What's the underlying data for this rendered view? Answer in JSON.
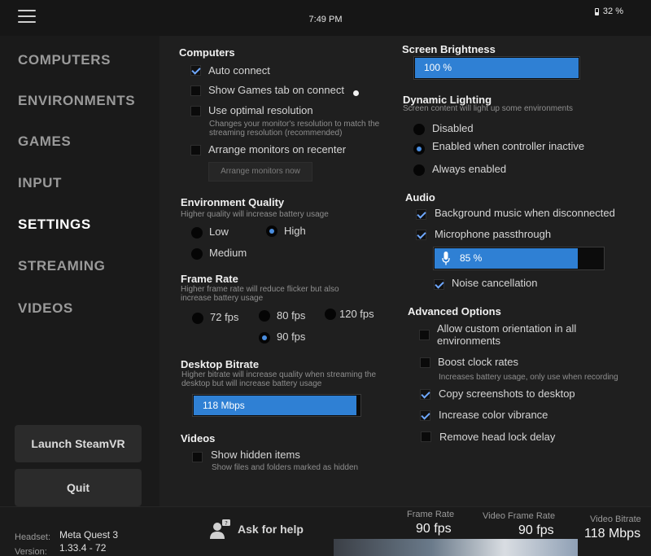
{
  "topbar": {
    "time": "7:49 PM",
    "battery": "32 %"
  },
  "sidebar": {
    "items": [
      {
        "label": "COMPUTERS",
        "active": false
      },
      {
        "label": "ENVIRONMENTS",
        "active": false
      },
      {
        "label": "GAMES",
        "active": false
      },
      {
        "label": "INPUT",
        "active": false
      },
      {
        "label": "SETTINGS",
        "active": true
      },
      {
        "label": "STREAMING",
        "active": false
      },
      {
        "label": "VIDEOS",
        "active": false
      }
    ],
    "launch_button": "Launch SteamVR",
    "quit_button": "Quit"
  },
  "settings": {
    "computers": {
      "title": "Computers",
      "auto_connect": {
        "label": "Auto connect",
        "checked": true
      },
      "show_games_tab": {
        "label": "Show Games tab on connect",
        "checked": false
      },
      "optimal_resolution": {
        "label": "Use optimal resolution",
        "checked": false,
        "desc": "Changes your monitor's resolution to match the streaming resolution (recommended)"
      },
      "arrange_monitors": {
        "label": "Arrange monitors on recenter",
        "checked": false
      },
      "arrange_now_button": "Arrange monitors now"
    },
    "environment_quality": {
      "title": "Environment Quality",
      "desc": "Higher quality will increase battery usage",
      "options": [
        "Low",
        "High",
        "Medium"
      ],
      "selected": "High"
    },
    "frame_rate": {
      "title": "Frame Rate",
      "desc": "Higher frame rate will reduce flicker but also increase battery usage",
      "options": [
        "72 fps",
        "80 fps",
        "120 fps",
        "90 fps"
      ],
      "selected": "90 fps"
    },
    "desktop_bitrate": {
      "title": "Desktop Bitrate",
      "desc": "Higher bitrate will increase quality when streaming the desktop but will increase battery usage",
      "value_label": "118 Mbps",
      "fraction": 0.98
    },
    "videos": {
      "title": "Videos",
      "show_hidden": {
        "label": "Show hidden items",
        "checked": false,
        "desc": "Show files and folders marked as hidden"
      }
    },
    "screen_brightness": {
      "title": "Screen Brightness",
      "value_label": "100 %",
      "fraction": 1.0
    },
    "dynamic_lighting": {
      "title": "Dynamic Lighting",
      "desc": "Screen content will light up some environments",
      "options": [
        "Disabled",
        "Enabled when controller inactive",
        "Always enabled"
      ],
      "selected": "Enabled when controller inactive"
    },
    "audio": {
      "title": "Audio",
      "background_music": {
        "label": "Background music when disconnected",
        "checked": true
      },
      "mic_passthrough": {
        "label": "Microphone passthrough",
        "checked": true
      },
      "mic_level_label": "85 %",
      "mic_fraction": 0.85,
      "noise_cancellation": {
        "label": "Noise cancellation",
        "checked": true
      }
    },
    "advanced": {
      "title": "Advanced Options",
      "custom_orientation": {
        "label": "Allow custom orientation in all environments",
        "checked": false
      },
      "boost_clock": {
        "label": "Boost clock rates",
        "checked": false,
        "desc": "Increases battery usage, only use when recording"
      },
      "copy_screenshots": {
        "label": "Copy screenshots to desktop",
        "checked": true
      },
      "color_vibrance": {
        "label": "Increase color vibrance",
        "checked": true
      },
      "head_lock_delay": {
        "label": "Remove head lock delay",
        "checked": false
      }
    }
  },
  "footer": {
    "headset_label": "Headset:",
    "headset_value": "Meta Quest 3",
    "version_label": "Version:",
    "version_value": "1.33.4 - 72",
    "help_button": "Ask for help",
    "frame_rate_label": "Frame Rate",
    "frame_rate_value": "90 fps",
    "video_frame_rate_label": "Video Frame Rate",
    "video_frame_rate_value": "90 fps",
    "video_bitrate_label": "Video Bitrate",
    "video_bitrate_value": "118 Mbps"
  },
  "colors": {
    "accent": "#2f80d4",
    "background": "#1f1f1f",
    "sidebar": "#1a1a1a"
  },
  "icons": [
    "hamburger-menu-icon",
    "battery-icon",
    "microphone-icon",
    "help-person-icon"
  ]
}
